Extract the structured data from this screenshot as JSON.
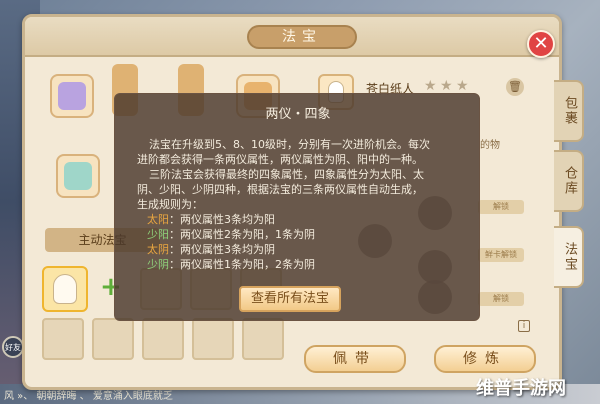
{
  "panel": {
    "title": "法宝",
    "close_symbol": "✕"
  },
  "left": {
    "active_skill_tab": "主动法宝"
  },
  "right": {
    "item_name": "苍白纸人",
    "star_symbol": "★",
    "partial_text": "的物",
    "unlock_label": "解锁",
    "unlock_label_2": "鲜卡解锁",
    "info_symbol": "i"
  },
  "buttons": {
    "equip": "佩带",
    "refine": "修炼"
  },
  "side_tabs": [
    "包裹",
    "仓库",
    "法宝"
  ],
  "popup": {
    "title": "两仪・四象",
    "lines": [
      "法宝在升级到5、8、10级时，分别有一次进阶机会。每次",
      "进阶都会获得一条两仪属性，两仪属性为阴、阳中的一种。",
      "三阶法宝会获得最终的四象属性，四象属性分为太阳、太",
      "阴、少阳、少阴四种，根据法宝的三条两仪属性自动生成，",
      "生成规则为："
    ],
    "rules": [
      {
        "key": "太阳",
        "sep": "：",
        "text": "两仪属性3条均为阳"
      },
      {
        "key": "少阳",
        "sep": "：",
        "text": "两仪属性2条为阳，1条为阴"
      },
      {
        "key": "太阴",
        "sep": "：",
        "text": "两仪属性3条均为阴"
      },
      {
        "key": "少阴",
        "sep": "：",
        "text": "两仪属性1条为阳，2条为阴"
      }
    ],
    "button_label": "查看所有法宝"
  },
  "background": {
    "chat_text": "风 »、 朝朝辞晦 、 爱意涌入眼底就乏 ",
    "side_chat": "好友",
    "watermark": "维普手游网"
  },
  "colors": {
    "popup_bg": "#4a382c",
    "key_yang": "#e9a640",
    "key_yin": "#8fd27a",
    "close_red": "#e04444"
  }
}
